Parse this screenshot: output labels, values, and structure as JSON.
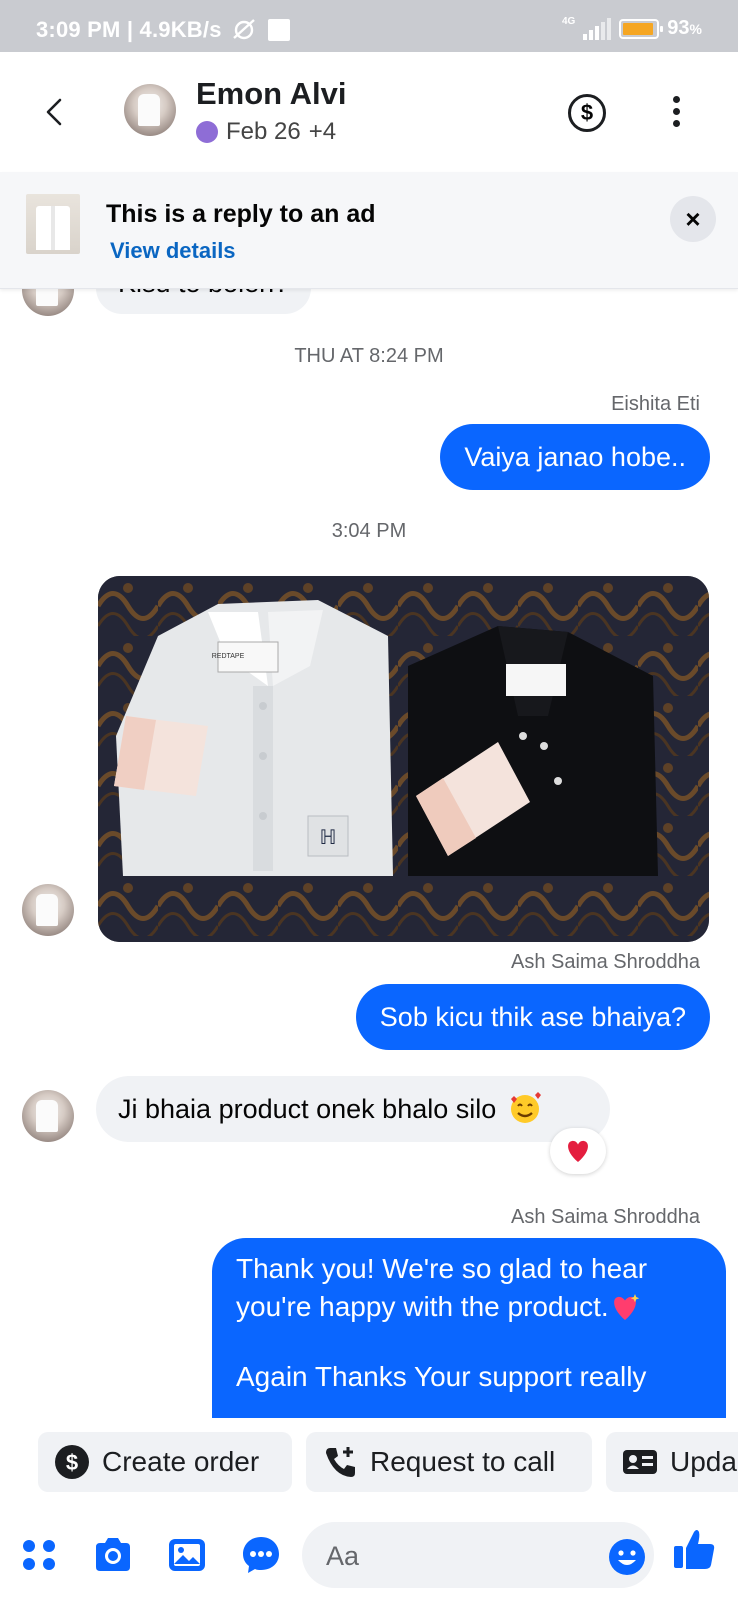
{
  "status_bar": {
    "time": "3:09 PM",
    "speed": "4.9KB/s",
    "network": "4G",
    "battery": "93",
    "battery_unit": "%",
    "battery_level": 0.93
  },
  "header": {
    "contact_name": "Emon Alvi",
    "date": "Feb 26",
    "extra_count": "+4",
    "icons": [
      "back-arrow-icon",
      "dollar-icon",
      "more-icon"
    ]
  },
  "ad_banner": {
    "title": "This is a reply to an ad",
    "link": "View details",
    "close": "×"
  },
  "messages": {
    "partial_top": "Kisu to bolen?",
    "timestamp1": "THU AT 8:24 PM",
    "sender1": "Eishita Eti",
    "out1": "Vaiya janao hobe..",
    "timestamp2": "3:04 PM",
    "photo_brand": "REDTAPE",
    "sender2": "Ash Saima Shroddha",
    "out2": "Sob kicu thik ase bhaiya?",
    "in1": "Ji bhaia product onek bhalo silo",
    "in1_emoji": "smiling-face-with-hearts",
    "reaction": "heart",
    "sender3": "Ash Saima Shroddha",
    "out3_line1": "Thank you! We're so glad to hear",
    "out3_line2": "you're happy with the product.",
    "out3_line3": "Again Thanks Your support really"
  },
  "quick_actions": [
    {
      "label": "Create order",
      "icon": "dollar-circle-icon"
    },
    {
      "label": "Request to call",
      "icon": "phone-add-icon"
    },
    {
      "label": "Upda",
      "icon": "contact-card-icon"
    }
  ],
  "composer": {
    "placeholder": "Aa",
    "icons": [
      "menu-dots-icon",
      "camera-icon",
      "gallery-icon",
      "chat-bubble-icon",
      "emoji-icon",
      "like-icon"
    ]
  },
  "colors": {
    "accent": "#0a66ff",
    "link": "#0a66c2",
    "bubble_in": "#f0f2f5",
    "status_bar": "#c9cbd0",
    "presence": "#8e6dd6",
    "battery": "#f5a623"
  }
}
